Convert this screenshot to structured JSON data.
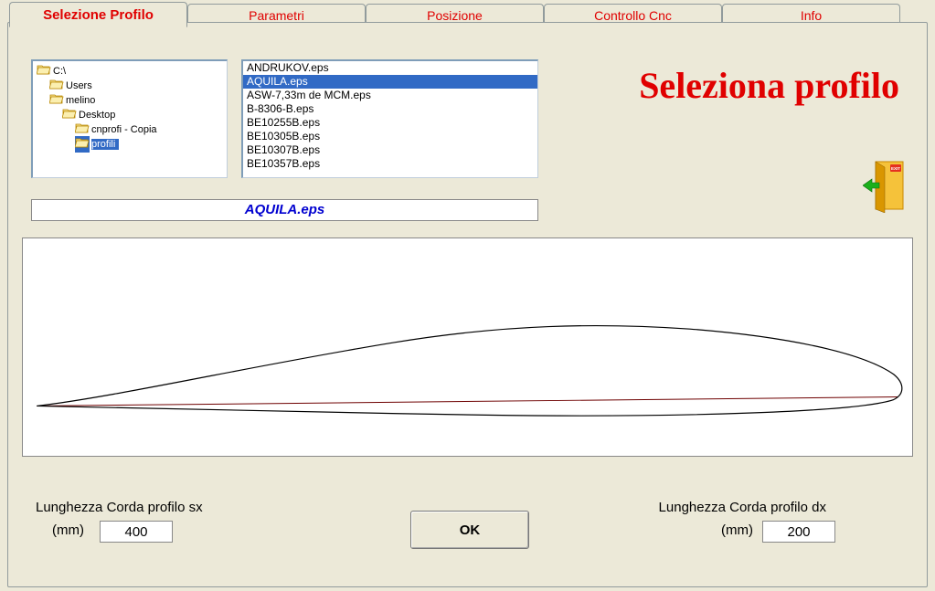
{
  "tabs": [
    {
      "label": "Selezione Profilo",
      "active": true
    },
    {
      "label": "Parametri",
      "active": false
    },
    {
      "label": "Posizione",
      "active": false
    },
    {
      "label": "Controllo Cnc",
      "active": false
    },
    {
      "label": "Info",
      "active": false
    }
  ],
  "heading": "Seleziona profilo",
  "tree": [
    {
      "label": "C:\\",
      "indent": 0,
      "open": true,
      "selected": false
    },
    {
      "label": "Users",
      "indent": 1,
      "open": true,
      "selected": false
    },
    {
      "label": "melino",
      "indent": 1,
      "open": true,
      "selected": false
    },
    {
      "label": "Desktop",
      "indent": 2,
      "open": true,
      "selected": false
    },
    {
      "label": "cnprofi - Copia",
      "indent": 3,
      "open": true,
      "selected": false
    },
    {
      "label": "profili",
      "indent": 3,
      "open": true,
      "selected": true
    }
  ],
  "files": [
    {
      "name": "ANDRUKOV.eps",
      "selected": false
    },
    {
      "name": "AQUILA.eps",
      "selected": true
    },
    {
      "name": "ASW-7,33m de MCM.eps",
      "selected": false
    },
    {
      "name": "B-8306-B.eps",
      "selected": false
    },
    {
      "name": "BE10255B.eps",
      "selected": false
    },
    {
      "name": "BE10305B.eps",
      "selected": false
    },
    {
      "name": "BE10307B.eps",
      "selected": false
    },
    {
      "name": "BE10357B.eps",
      "selected": false
    }
  ],
  "selected_file": "AQUILA.eps",
  "chord_sx": {
    "label": "Lunghezza Corda profilo sx",
    "unit": "(mm)",
    "value": "400"
  },
  "chord_dx": {
    "label": "Lunghezza Corda profilo dx",
    "unit": "(mm)",
    "value": "200"
  },
  "ok_label": "OK",
  "exit_label": "EXIT"
}
